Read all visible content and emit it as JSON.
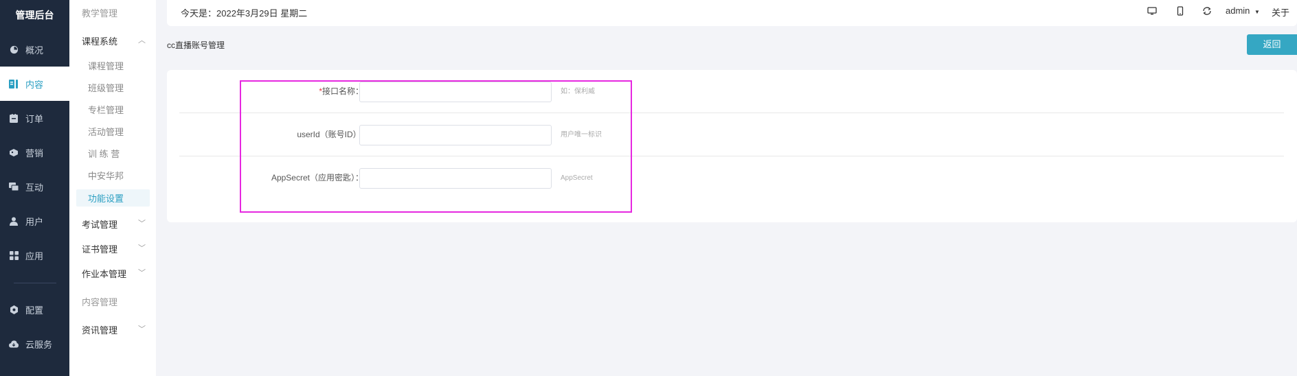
{
  "sidebar": {
    "brand": "管理后台",
    "items": [
      {
        "label": "概况",
        "icon": "dashboard-icon"
      },
      {
        "label": "内容",
        "icon": "content-icon",
        "active": true
      },
      {
        "label": "订单",
        "icon": "order-icon"
      },
      {
        "label": "营销",
        "icon": "marketing-icon"
      },
      {
        "label": "互动",
        "icon": "chat-icon"
      },
      {
        "label": "用户",
        "icon": "user-icon"
      },
      {
        "label": "应用",
        "icon": "apps-icon"
      },
      {
        "label": "配置",
        "icon": "settings-icon"
      },
      {
        "label": "云服务",
        "icon": "cloud-icon"
      }
    ]
  },
  "subnav": {
    "teaching": "教学管理",
    "course_system": "课程系统",
    "links": [
      "课程管理",
      "班级管理",
      "专栏管理",
      "活动管理",
      "训 练 营",
      "中安华邦",
      "功能设置"
    ],
    "exam": "考试管理",
    "certificate": "证书管理",
    "homework": "作业本管理",
    "content_mgmt": "内容管理",
    "news": "资讯管理"
  },
  "topbar": {
    "date": "今天是：2022年3月29日 星期二",
    "user": "admin",
    "about": "关于",
    "icons": [
      "monitor-icon",
      "phone-icon",
      "refresh-icon"
    ]
  },
  "page": {
    "title": "cc直播账号管理",
    "back": "返回"
  },
  "form": {
    "fields": [
      {
        "required": "*",
        "label": "接口名称：",
        "value": "",
        "placeholder": "",
        "hint": "如：保利威"
      },
      {
        "required": "",
        "label": "userId（账号ID）:",
        "value": "",
        "placeholder": "",
        "hint": "用户唯一标识"
      },
      {
        "required": "",
        "label": "AppSecret（应用密匙）：",
        "value": "",
        "placeholder": "",
        "hint": "AppSecret"
      }
    ]
  },
  "colors": {
    "sidebar_bg": "#1e2a3d",
    "accent": "#2b9fc2",
    "back_button": "#35a7c3",
    "highlight": "#e627e0"
  }
}
